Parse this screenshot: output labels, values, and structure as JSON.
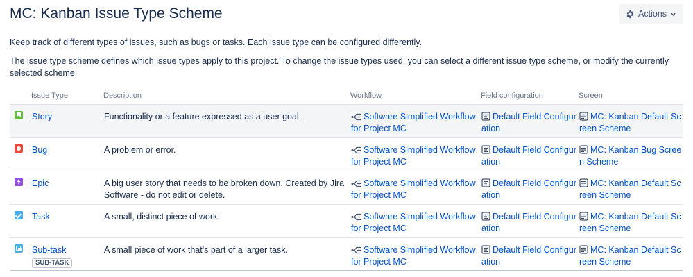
{
  "header": {
    "title": "MC: Kanban Issue Type Scheme",
    "actions_label": "Actions"
  },
  "descriptions": {
    "line1": "Keep track of different types of issues, such as bugs or tasks. Each issue type can be configured differently.",
    "line2": "The issue type scheme defines which issue types apply to this project. To change the issue types used, you can select a different issue type scheme, or modify the currently selected scheme."
  },
  "table": {
    "columns": {
      "issue_type": "Issue Type",
      "description": "Description",
      "workflow": "Workflow",
      "field_configuration": "Field configuration",
      "screen": "Screen"
    },
    "rows": [
      {
        "icon": "story-icon",
        "name": "Story",
        "description": "Functionality or a feature expressed as a user goal.",
        "workflow": "Software Simplified Workflow for Project MC",
        "field_config": "Default Field Configuration",
        "screen": "MC: Kanban Default Screen Scheme"
      },
      {
        "icon": "bug-icon",
        "name": "Bug",
        "description": "A problem or error.",
        "workflow": "Software Simplified Workflow for Project MC",
        "field_config": "Default Field Configuration",
        "screen": "MC: Kanban Bug Screen Scheme"
      },
      {
        "icon": "epic-icon",
        "name": "Epic",
        "description": "A big user story that needs to be broken down. Created by Jira Software - do not edit or delete.",
        "workflow": "Software Simplified Workflow for Project MC",
        "field_config": "Default Field Configuration",
        "screen": "MC: Kanban Default Screen Scheme"
      },
      {
        "icon": "task-icon",
        "name": "Task",
        "description": "A small, distinct piece of work.",
        "workflow": "Software Simplified Workflow for Project MC",
        "field_config": "Default Field Configuration",
        "screen": "MC: Kanban Default Screen Scheme"
      },
      {
        "icon": "subtask-icon",
        "name": "Sub-task",
        "badge": "SUB-TASK",
        "description": "A small piece of work that's part of a larger task.",
        "workflow": "Software Simplified Workflow for Project MC",
        "field_config": "Default Field Configuration",
        "screen": "MC: Kanban Default Screen Scheme"
      }
    ]
  },
  "colors": {
    "link": "#0052cc",
    "text": "#172b4d",
    "muted": "#6b778c",
    "highlight_row": "#f4f5f7",
    "story": "#63ba3c",
    "bug": "#e5493a",
    "epic": "#904ee2",
    "task": "#4bade8"
  }
}
